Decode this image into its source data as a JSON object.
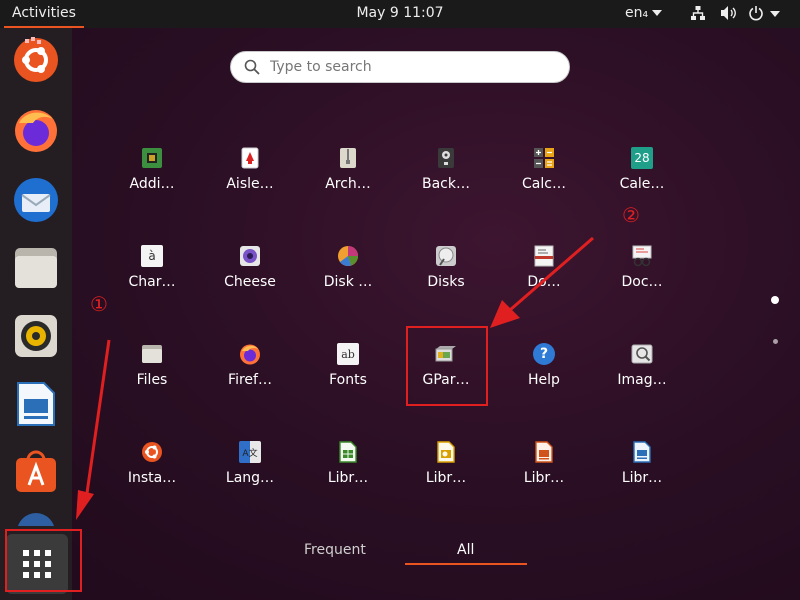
{
  "topbar": {
    "activities": "Activities",
    "clock": "May 9  11:07",
    "language": "en₄"
  },
  "search": {
    "placeholder": "Type to search"
  },
  "apps": [
    {
      "label": "Addi…",
      "icon": "addons-icon"
    },
    {
      "label": "Aisle…",
      "icon": "aisleriot-cards-icon"
    },
    {
      "label": "Arch…",
      "icon": "archive-manager-icon"
    },
    {
      "label": "Back…",
      "icon": "backups-icon"
    },
    {
      "label": "Calc…",
      "icon": "calculator-icon"
    },
    {
      "label": "Cale…",
      "icon": "calendar-icon",
      "badge": "28"
    },
    {
      "label": "Char…",
      "icon": "characters-icon",
      "badge": "à"
    },
    {
      "label": "Cheese",
      "icon": "cheese-webcam-icon"
    },
    {
      "label": "Disk …",
      "icon": "disk-usage-icon"
    },
    {
      "label": "Disks",
      "icon": "disks-icon"
    },
    {
      "label": "Do…",
      "icon": "document-viewer-icon"
    },
    {
      "label": "Doc…",
      "icon": "document-scanner-icon"
    },
    {
      "label": "Files",
      "icon": "files-folder-icon"
    },
    {
      "label": "Firef…",
      "icon": "firefox-icon"
    },
    {
      "label": "Fonts",
      "icon": "fonts-icon",
      "badge": "ab"
    },
    {
      "label": "GPar…",
      "icon": "gparted-icon"
    },
    {
      "label": "Help",
      "icon": "help-icon",
      "badge": "?"
    },
    {
      "label": "Imag…",
      "icon": "image-viewer-icon"
    },
    {
      "label": "Insta…",
      "icon": "ubuntu-installer-icon"
    },
    {
      "label": "Lang…",
      "icon": "language-support-icon",
      "badge": "A文"
    },
    {
      "label": "Libr…",
      "icon": "libreoffice-calc-icon"
    },
    {
      "label": "Libr…",
      "icon": "libreoffice-draw-icon"
    },
    {
      "label": "Libr…",
      "icon": "libreoffice-impress-icon"
    },
    {
      "label": "Libr…",
      "icon": "libreoffice-writer-icon"
    }
  ],
  "dock": [
    {
      "name": "ubuntu-software-center-icon"
    },
    {
      "name": "firefox-icon"
    },
    {
      "name": "thunderbird-icon"
    },
    {
      "name": "files-icon"
    },
    {
      "name": "rhythmbox-icon"
    },
    {
      "name": "libreoffice-writer-icon"
    },
    {
      "name": "ubuntu-software-icon"
    },
    {
      "name": "help-icon"
    }
  ],
  "tabs": {
    "frequent": "Frequent",
    "all": "All"
  },
  "annotations": {
    "step1": "①",
    "step2": "②"
  },
  "colors": {
    "accent": "#e95420",
    "annotation": "#e02020",
    "topbar": "#1a1a1a",
    "dock": "#241e22"
  }
}
